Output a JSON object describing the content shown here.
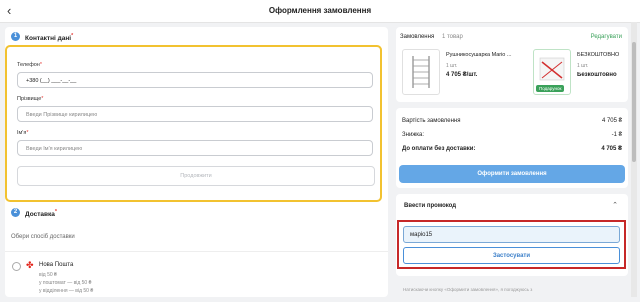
{
  "header": {
    "back_icon": "‹",
    "title": "Оформлення замовлення"
  },
  "contacts": {
    "step": "1",
    "heading": "Контактні дані",
    "required_mark": "*",
    "phone_label": "Телефон",
    "phone_value": "+380 (__) ___-__-__",
    "surname_label": "Прізвище",
    "surname_placeholder": "Введи Прізвище кирилицею",
    "name_label": "Ім'я",
    "name_placeholder": "Введи Ім'я кирилицею",
    "continue_label": "Продовжити"
  },
  "delivery": {
    "step": "2",
    "heading": "Доставка",
    "choose_label": "Обери спосіб доставки",
    "option_name": "Нова Пошта",
    "from_price": "від 50 ₴",
    "line_postomat": "у поштомат — від 50 ₴",
    "line_branch": "у відділення — від 50 ₴"
  },
  "order": {
    "label": "Замовлення",
    "count": "1 товар",
    "edit_label": "Редагувати",
    "item1": {
      "name": "Рушникосушарка Mario ...",
      "qty": "1 шт.",
      "price": "4 705 ₴/шт."
    },
    "item2": {
      "name": "БЕЗКОШТОВНО",
      "qty": "1 шт.",
      "price": "Безкоштовно",
      "badge": "Подарунок"
    }
  },
  "summary": {
    "cost_label": "Вартість замовлення",
    "cost_value": "4 705 ₴",
    "discount_label": "Знижка:",
    "discount_value": "-1 ₴",
    "total_label": "До оплати без доставки:",
    "total_value": "4 705 ₴",
    "order_button": "Оформити замовлення"
  },
  "promo": {
    "heading": "Ввести промокод",
    "chevron_icon": "chevron-up",
    "input_value": "маріо15",
    "apply_button": "Застосувати"
  },
  "footer_text": "Натискаючи кнопку «Оформити замовлення», я погоджуюсь з"
}
